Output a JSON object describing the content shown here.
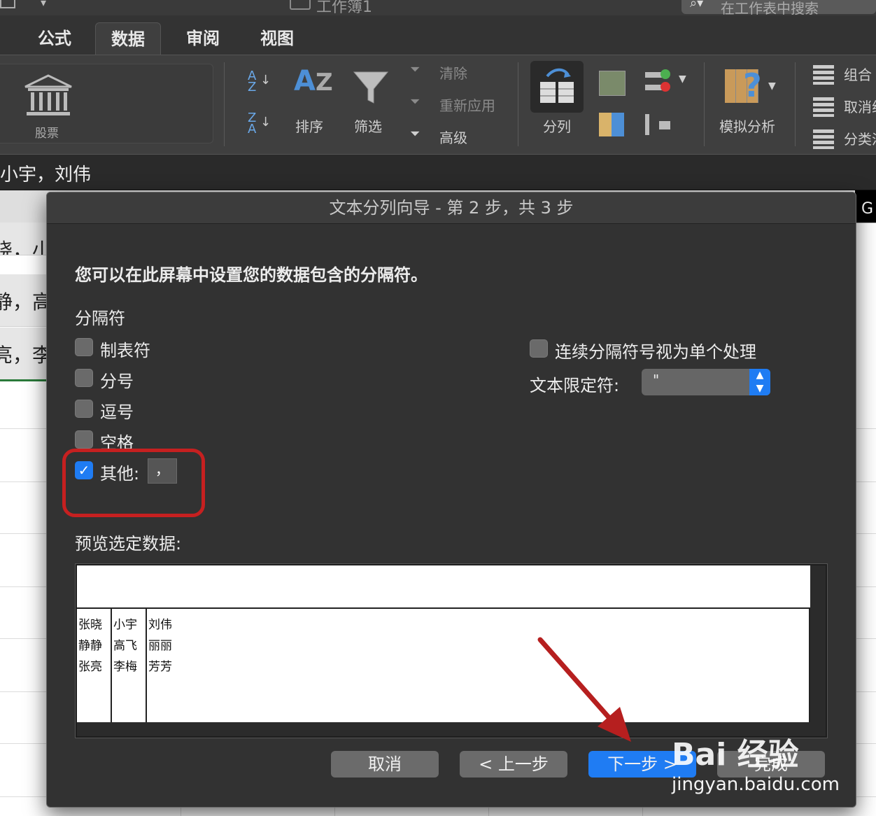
{
  "window": {
    "title": "工作簿1",
    "search_placeholder": "在工作表中搜索"
  },
  "ribbon_tabs": [
    "公式",
    "数据",
    "审阅",
    "视图"
  ],
  "ribbon": {
    "stocks": "股票",
    "sort": "排序",
    "filter": "筛选",
    "clear": "清除",
    "reapply": "重新应用",
    "advanced": "高级",
    "text_to_columns": "分列",
    "what_if": "模拟分析",
    "group": "组合",
    "ungroup": "取消组合",
    "subtotal": "分类汇总"
  },
  "formula_bar": {
    "value": "小宇，刘伟"
  },
  "sheet_partial": {
    "rows": [
      "晓，小",
      "静，高",
      "亮，李"
    ],
    "col_header_right": "G"
  },
  "dialog": {
    "title": "文本分列向导 - 第 2 步，共 3 步",
    "instruction": "您可以在此屏幕中设置您的数据包含的分隔符。",
    "delimiters_heading": "分隔符",
    "tab": "制表符",
    "semicolon": "分号",
    "comma": "逗号",
    "space": "空格",
    "other": "其他:",
    "other_value": "，",
    "treat_consecutive": "连续分隔符号视为单个处理",
    "qualifier_label": "文本限定符:",
    "qualifier_value": "\"",
    "preview_label": "预览选定数据:",
    "preview": [
      [
        "张晓",
        "小宇",
        "刘伟"
      ],
      [
        "静静",
        "高飞",
        "丽丽"
      ],
      [
        "张亮",
        "李梅",
        "芳芳"
      ]
    ],
    "cancel": "取消",
    "back": "< 上一步",
    "next": "下一步 >",
    "finish": "完成"
  },
  "checkbox_state": {
    "tab": false,
    "semicolon": false,
    "comma": false,
    "space": false,
    "other": true,
    "treat_consecutive": false
  },
  "watermark": {
    "logo": "Bai 经验",
    "url": "jingyan.baidu.com"
  },
  "colors": {
    "accent": "#1f7cf3",
    "highlight": "#c62020",
    "arrow": "#b61f1f"
  }
}
